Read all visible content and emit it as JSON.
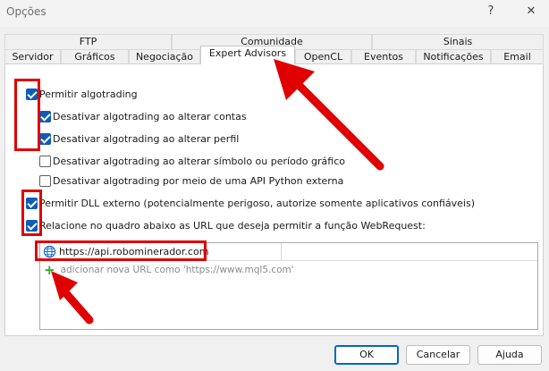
{
  "window": {
    "title": "Opções",
    "help_glyph": "?",
    "close_glyph": "✕"
  },
  "tabs_top": [
    "FTP",
    "Comunidade",
    "Sinais"
  ],
  "tabs_bottom": [
    "Servidor",
    "Gráficos",
    "Negociação",
    "Expert Advisors",
    "OpenCL",
    "Eventos",
    "Notificações",
    "Email"
  ],
  "selected_tab": "Expert Advisors",
  "options": [
    {
      "label": "Permitir algotrading",
      "checked": true
    },
    {
      "label": "Desativar algotrading ao alterar contas",
      "checked": true
    },
    {
      "label": "Desativar algotrading ao alterar perfil",
      "checked": true
    },
    {
      "label": "Desativar algotrading ao alterar símbolo ou período gráfico",
      "checked": false
    },
    {
      "label": "Desativar algotrading por meio de uma API Python externa",
      "checked": false
    },
    {
      "label": "Permitir DLL externo (potencialmente perigoso, autorize somente aplicativos confiáveis)",
      "checked": true
    },
    {
      "label": "Relacione no quadro abaixo as URL que deseja permitir a função WebRequest:",
      "checked": true
    }
  ],
  "url_list": {
    "entries": [
      "https://api.robominerador.com"
    ],
    "add_placeholder": "adicionar nova URL como 'https://www.mql5.com'",
    "url_icon": "globe-icon",
    "add_icon": "plus-icon"
  },
  "buttons": {
    "ok": "OK",
    "cancel": "Cancelar",
    "help": "Ajuda"
  },
  "colors": {
    "checkbox_checked": "#0d5db8",
    "highlight": "#e00000",
    "add_icon": "#2ea52e",
    "default_button_border": "#0067c0"
  }
}
